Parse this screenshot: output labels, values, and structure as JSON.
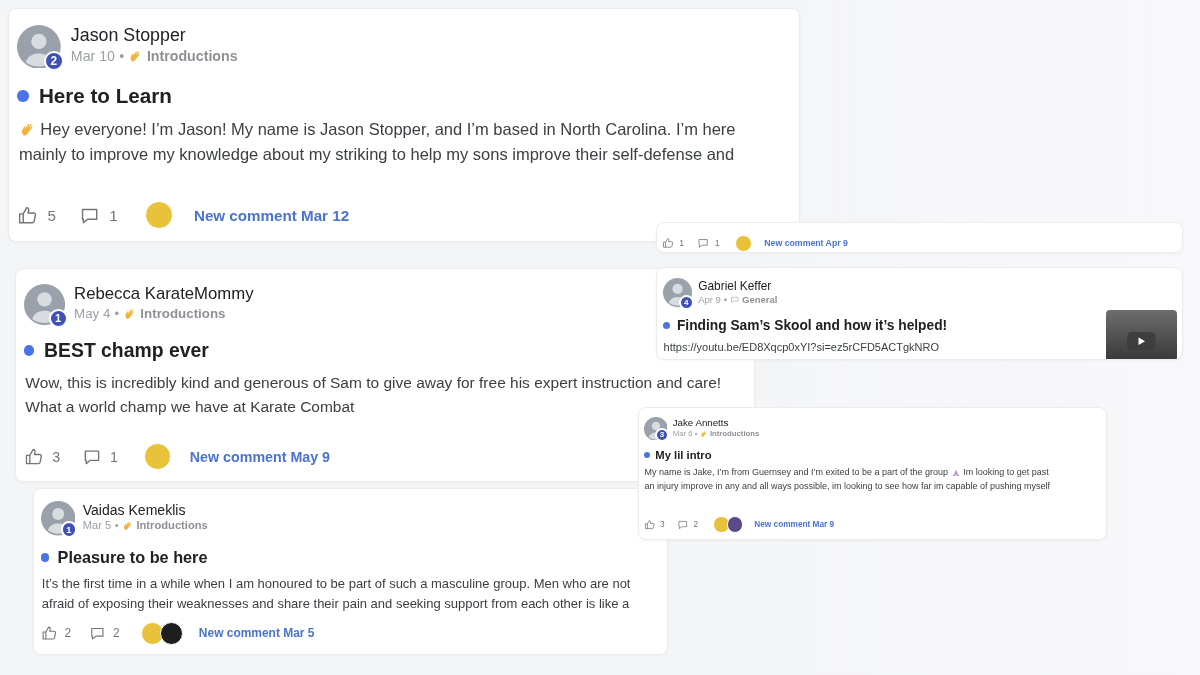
{
  "posts": [
    {
      "kind": "post",
      "author": "Jason Stopper",
      "badge": "2",
      "date": "Mar 10",
      "separator": "•",
      "category": {
        "kind": "wave",
        "label": "Introductions"
      },
      "unread": true,
      "title": "Here to Learn",
      "lines": [
        [
          {
            "kind": "wave"
          },
          {
            "kind": "text",
            "text": "Hey everyone! I’m Jason! My name is Jason Stopper, and I’m based in North Carolina. I’m here"
          }
        ],
        [
          {
            "kind": "text",
            "text": "mainly to improve my knowledge about my striking to help my sons improve their self-defense and"
          }
        ]
      ],
      "likes": "5",
      "comments": "1",
      "commenters": [
        {
          "color": "#e8c23a"
        }
      ],
      "new_comment": "New comment Mar 12"
    },
    {
      "kind": "post",
      "author": "Rebecca KarateMommy",
      "badge": "1",
      "date": "May 4",
      "separator": "•",
      "category": {
        "kind": "wave",
        "label": "Introductions"
      },
      "unread": true,
      "title": "BEST champ ever",
      "lines": [
        [
          {
            "kind": "text",
            "text": "Wow, this is incredibly kind and generous of Sam to give away for free his expert instruction and care!"
          }
        ],
        [
          {
            "kind": "text",
            "text": "What a world champ we have at Karate Combat"
          }
        ]
      ],
      "likes": "3",
      "comments": "1",
      "commenters": [
        {
          "color": "#e8c23a"
        }
      ],
      "new_comment": "New comment May 9"
    },
    {
      "kind": "post",
      "author": "Vaidas Kemeklis",
      "badge": "1",
      "date": "Mar 5",
      "separator": "•",
      "category": {
        "kind": "wave",
        "label": "Introductions"
      },
      "unread": true,
      "title": "Pleasure to be here",
      "lines": [
        [
          {
            "kind": "text",
            "text": "It’s the first time in a while when I am honoured to be part of such a masculine group. Men who are not"
          }
        ],
        [
          {
            "kind": "text",
            "text": "afraid of exposing their weaknesses and share their pain and seeking support from each other is like a"
          }
        ]
      ],
      "likes": "2",
      "comments": "2",
      "commenters": [
        {
          "color": "#e8c23a"
        },
        {
          "color": "#1e1e1e"
        }
      ],
      "new_comment": "New comment Mar 5"
    },
    {
      "kind": "footer_only",
      "likes": "1",
      "comments": "1",
      "commenters": [
        {
          "color": "#e8c23a"
        }
      ],
      "new_comment": "New comment Apr 9"
    },
    {
      "kind": "post",
      "author": "Gabriel Keffer",
      "badge": "4",
      "date": "Apr 9",
      "separator": "•",
      "category": {
        "kind": "chat",
        "label": "General"
      },
      "unread": true,
      "title": "Finding Sam’s Skool and how it’s helped!",
      "lines": [
        [
          {
            "kind": "link",
            "text": "https://youtu.be/ED8Xqcp0xYI?si=ez5rCFD5ACTgkNRO"
          }
        ]
      ],
      "video_thumbnail": true
    },
    {
      "kind": "post",
      "author": "Jake Annetts",
      "badge": "3",
      "date": "Mar 6",
      "separator": "•",
      "category": {
        "kind": "wave",
        "label": "Introductions"
      },
      "unread": true,
      "title": "My lil intro",
      "lines": [
        [
          {
            "kind": "text",
            "text": "My name is Jake, I’m from Guernsey and I’m exited to be a part of the group"
          },
          {
            "kind": "pray"
          },
          {
            "kind": "text",
            "text": "Im looking to get past"
          }
        ],
        [
          {
            "kind": "text",
            "text": "an injury improve in any and all ways possible, im looking to see how far im capable of pushing myself"
          }
        ]
      ],
      "likes": "3",
      "comments": "2",
      "commenters": [
        {
          "color": "#e8c23a"
        },
        {
          "color": "#5a4a8a"
        }
      ],
      "new_comment": "New comment Mar 9"
    }
  ]
}
